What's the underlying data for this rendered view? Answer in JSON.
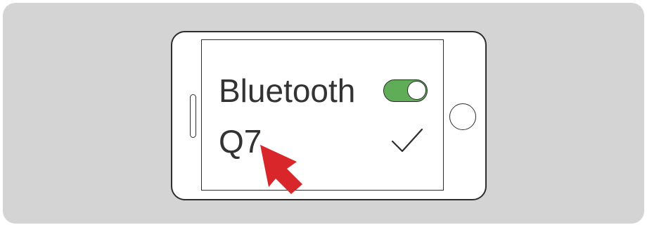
{
  "bluetooth_setting": {
    "label": "Bluetooth",
    "toggle_state": "on",
    "toggle_color": "#5fad56"
  },
  "device": {
    "name": "Q7",
    "selected": true,
    "selected_icon": "checkmark-icon"
  },
  "pointer": {
    "icon": "arrow-pointer-icon",
    "color": "#d9262b"
  },
  "colors": {
    "background_panel": "#d4d4d5",
    "outline": "#2d2d2d",
    "text": "#333333"
  }
}
